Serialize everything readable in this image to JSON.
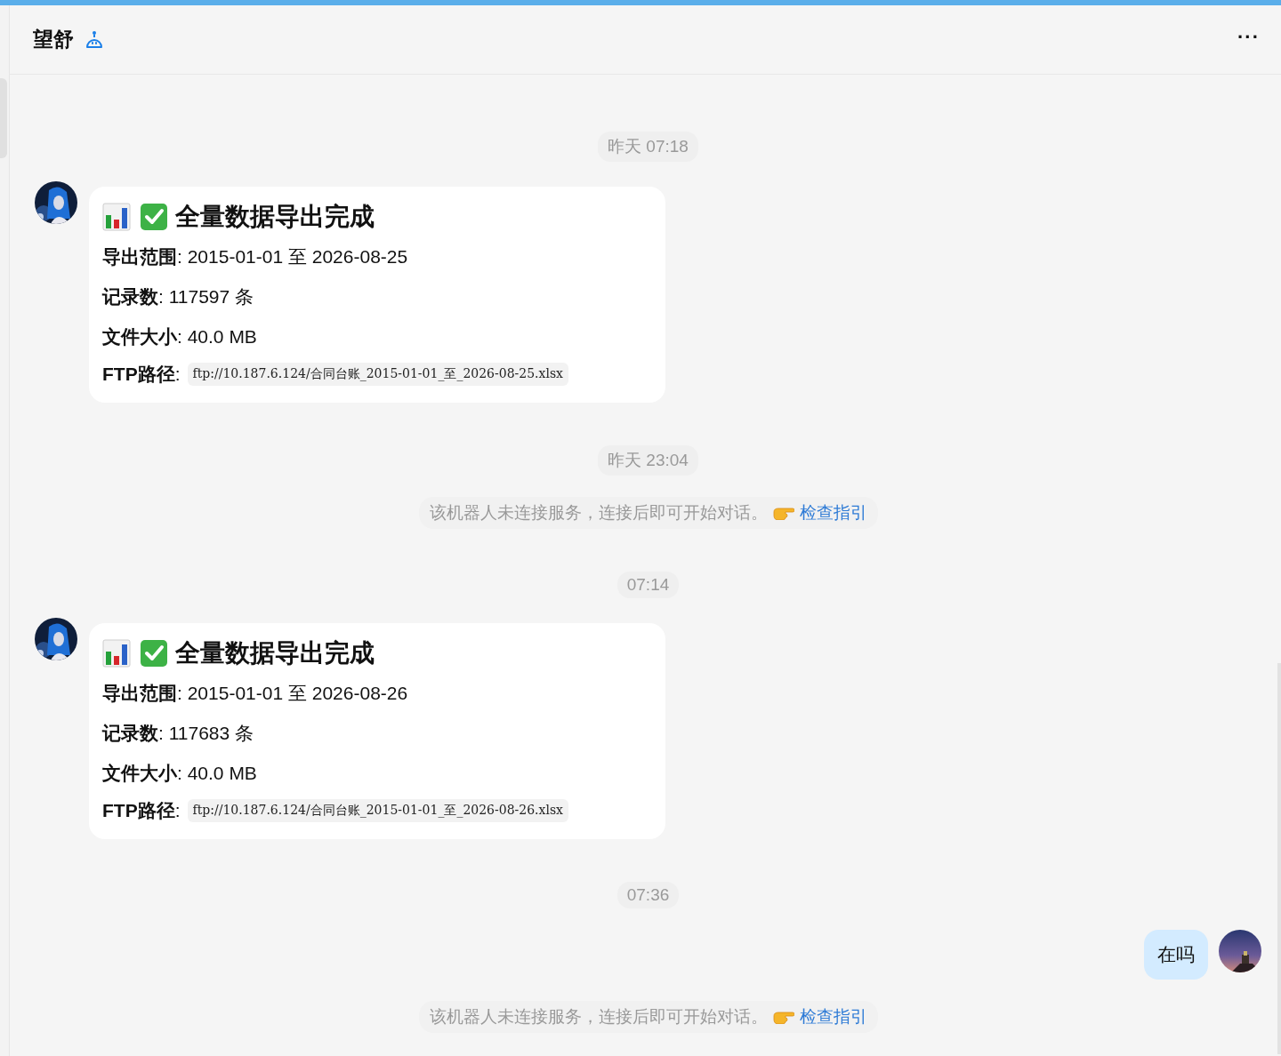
{
  "header": {
    "title": "望舒",
    "menu": "···"
  },
  "messages": [
    {
      "kind": "time",
      "text": "昨天 07:18"
    },
    {
      "kind": "bot_card",
      "title": "全量数据导出完成",
      "lines": [
        "**导出范围**: 2015-01-01 至 2026-08-25",
        "**记录数**: 117597 条",
        "**文件大小**: 40.0 MB"
      ],
      "path_label": "**FTP路径**:",
      "path": "ftp://10.187.6.124/合同台账_2015-01-01_至_2026-08-25.xlsx"
    },
    {
      "kind": "time",
      "text": "昨天 23:04"
    },
    {
      "kind": "notice",
      "text": "该机器人未连接服务，连接后即可开始对话。",
      "link": "检查指引"
    },
    {
      "kind": "time",
      "text": "07:14"
    },
    {
      "kind": "bot_card",
      "title": "全量数据导出完成",
      "lines": [
        "**导出范围**: 2015-01-01 至 2026-08-26",
        "**记录数**: 117683 条",
        "**文件大小**: 40.0 MB"
      ],
      "path_label": "**FTP路径**:",
      "path": "ftp://10.187.6.124/合同台账_2015-01-01_至_2026-08-26.xlsx"
    },
    {
      "kind": "time",
      "text": "07:36"
    },
    {
      "kind": "user",
      "text": "在吗"
    },
    {
      "kind": "notice",
      "text": "该机器人未连接服务，连接后即可开始对话。",
      "link": "检查指引"
    }
  ]
}
